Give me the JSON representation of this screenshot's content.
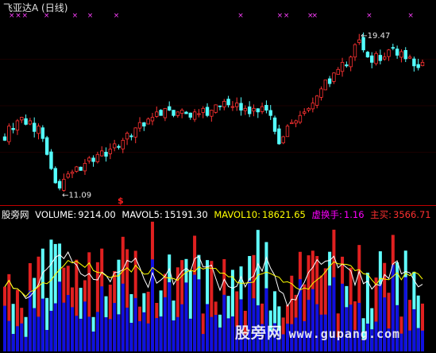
{
  "window": {
    "title": "飞亚达A (日线)"
  },
  "price_chart": {
    "high_label": "19.47",
    "low_label": "11.09",
    "signal_marker": "$",
    "high_arrow": "←",
    "low_arrow": "←",
    "ymin": 10.5,
    "ymax": 21.0,
    "candle_up_color": "#ff3232",
    "candle_down_color": "#54ffff"
  },
  "indicator": {
    "source": "股旁网",
    "volume_label": "VOLUME:",
    "volume_value": "9214.00",
    "mavol5_label": "MAVOL5:",
    "mavol5_value": "15191.30",
    "mavol10_label": "MAVOL10:",
    "mavol10_value": "18621.65",
    "turnover_label": "虚换手:",
    "turnover_value": "1.16",
    "main_buy_label": "主买:",
    "main_buy_value": "3566.71",
    "colors": {
      "volume": "#ffffff",
      "mavol5": "#ffffff",
      "mavol10": "#ffff00",
      "turnover": "#ff00ff",
      "main_buy": "#ff3030"
    }
  },
  "watermark": {
    "text": "股旁网",
    "url": "www.gupang.com"
  },
  "chart_data": {
    "type": "line",
    "series": [
      {
        "values": [
          13.8,
          14.6,
          14.4,
          14.9,
          15.1,
          14.7,
          14.9,
          14.3,
          14.6,
          13.9,
          13.0,
          12.2,
          11.4,
          11.1,
          11.6,
          11.9,
          12.0,
          12.3,
          12.1,
          12.5,
          12.8,
          12.6,
          13.0,
          13.2,
          12.9,
          13.3,
          13.6,
          13.4,
          13.8,
          14.2,
          14.0,
          14.5,
          14.8,
          14.6,
          15.0,
          15.1,
          15.4,
          15.2,
          15.6,
          15.5,
          15.2,
          15.4,
          15.5,
          15.3,
          15.1,
          15.4,
          15.3,
          15.6,
          15.2,
          15.5,
          15.8,
          15.7,
          16.0,
          15.8,
          15.7,
          15.9,
          15.5,
          15.6,
          15.3,
          15.6,
          15.4,
          15.7,
          15.5,
          15.2,
          14.3,
          13.6,
          14.0,
          14.6,
          14.8,
          14.9,
          15.2,
          15.4,
          15.6,
          15.9,
          16.3,
          16.7,
          17.2,
          17.0,
          17.6,
          17.8,
          18.2,
          18.0,
          18.5,
          19.2,
          19.47,
          18.9,
          18.5,
          18.2,
          18.7,
          18.3,
          18.5,
          18.9,
          19.0,
          18.6,
          18.8,
          18.4,
          18.5,
          18.0,
          17.9,
          18.2
        ]
      }
    ],
    "ylim": [
      10.5,
      21.0
    ],
    "annotations": [
      "19.47",
      "11.09"
    ]
  }
}
